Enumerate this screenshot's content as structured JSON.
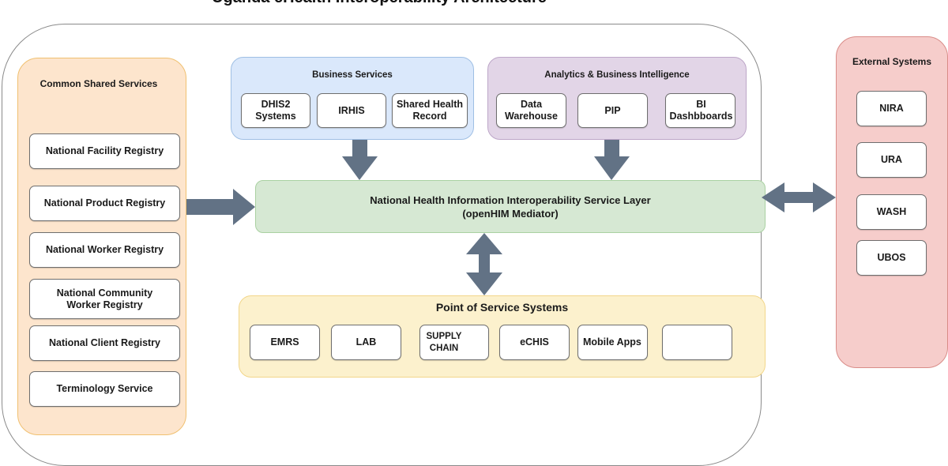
{
  "title": "Uganda eHealth Interoperability Architecture",
  "colors": {
    "shared_fill": "#fde5cd",
    "business_fill": "#dae8fb",
    "analytics_fill": "#e2d5e7",
    "layer_fill": "#d6e8d3",
    "pos_fill": "#fcf1cd",
    "external_fill": "#f6cdcb",
    "arrow": "#627285"
  },
  "shared_services": {
    "title": "Common Shared Services",
    "items": [
      "National Facility Registry",
      "National Product Registry",
      "National Worker Registry",
      "National Community Worker Registry",
      "National Client Registry",
      "Terminology Service"
    ]
  },
  "business_services": {
    "title": "Business Services",
    "items": [
      "DHIS2 Systems",
      "IRHIS",
      "Shared Health Record"
    ]
  },
  "analytics": {
    "title": "Analytics & Business Intelligence",
    "items": [
      "Data Warehouse",
      "PIP",
      "BI Dashbboards"
    ]
  },
  "service_layer": {
    "line1": "National Health Information Interoperability Service Layer",
    "line2": "(openHIM Mediator)"
  },
  "point_of_service": {
    "title": "Point of Service Systems",
    "items": [
      "EMRS",
      "LAB",
      "SUPPLY CHAIN",
      "eCHIS",
      "Mobile Apps",
      ""
    ]
  },
  "external_systems": {
    "title": "External Systems",
    "items": [
      "NIRA",
      "URA",
      "WASH",
      "UBOS"
    ]
  },
  "arrows": [
    {
      "from": "shared_services",
      "to": "service_layer",
      "direction": "one-way"
    },
    {
      "from": "business_services",
      "to": "service_layer",
      "direction": "one-way"
    },
    {
      "from": "analytics",
      "to": "service_layer",
      "direction": "one-way"
    },
    {
      "from": "service_layer",
      "to": "point_of_service",
      "direction": "two-way"
    },
    {
      "from": "service_layer",
      "to": "external_systems",
      "direction": "two-way"
    }
  ]
}
